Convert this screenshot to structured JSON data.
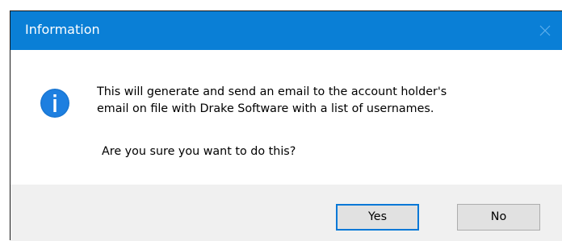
{
  "window": {
    "title": "Information",
    "close_icon": "close-icon",
    "accent_color": "#0a7fd6"
  },
  "content": {
    "icon": "info-icon",
    "message_line1": "This will generate and send an email to the account holder's",
    "message_line2": "email on file with Drake Software with a list of usernames.",
    "question": "Are you sure you want to do this?"
  },
  "buttons": {
    "yes_label": "Yes",
    "no_label": "No"
  }
}
